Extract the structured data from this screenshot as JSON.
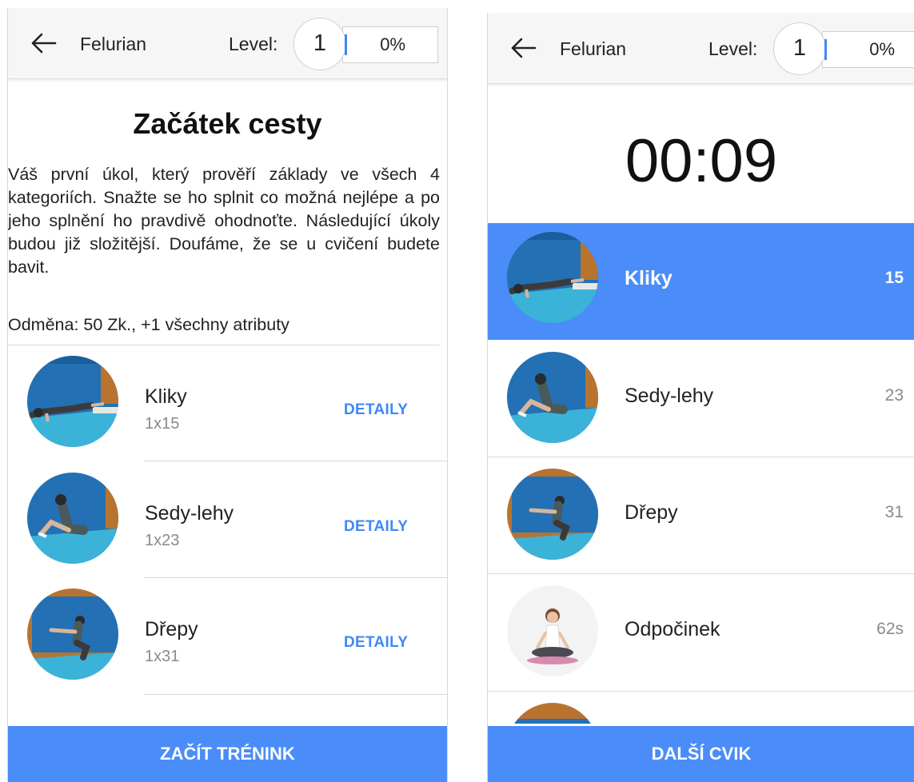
{
  "left_screen": {
    "header": {
      "user": "Felurian",
      "level_label": "Level:",
      "level": "1",
      "progress": "0%"
    },
    "title": "Začátek cesty",
    "description": "Váš první úkol, který prověří základy ve všech 4 kategoriích. Snažte se ho splnit co možná nejlépe a po jeho splnění ho pravdivě ohodnoťte. Následující úkoly budou již složitější. Doufáme, že se u cvičení budete bavit.",
    "reward": "Odměna: 50 Zk., +1 všechny atributy",
    "exercises": [
      {
        "name": "Kliky",
        "sets": "1x15",
        "action": "DETAILY",
        "icon": "pushup-photo"
      },
      {
        "name": "Sedy-lehy",
        "sets": "1x23",
        "action": "DETAILY",
        "icon": "situp-photo"
      },
      {
        "name": "Dřepy",
        "sets": "1x31",
        "action": "DETAILY",
        "icon": "squat-photo"
      }
    ],
    "button": "ZAČÍT TRÉNINK"
  },
  "right_screen": {
    "header": {
      "user": "Felurian",
      "level_label": "Level:",
      "level": "1",
      "progress": "0%"
    },
    "timer": "00:09",
    "queue": [
      {
        "name": "Kliky",
        "count": "15",
        "active": true,
        "icon": "pushup-photo"
      },
      {
        "name": "Sedy-lehy",
        "count": "23",
        "active": false,
        "icon": "situp-photo"
      },
      {
        "name": "Dřepy",
        "count": "31",
        "active": false,
        "icon": "squat-photo"
      },
      {
        "name": "Odpočinek",
        "count": "62s",
        "active": false,
        "icon": "rest-yoga-photo"
      }
    ],
    "button": "DALŠÍ CVIK"
  },
  "colors": {
    "accent": "#4a8df8",
    "appbar": "#f6f6f6",
    "gym_blue": "#1f6fb8",
    "mat": "#3cb0d8"
  }
}
